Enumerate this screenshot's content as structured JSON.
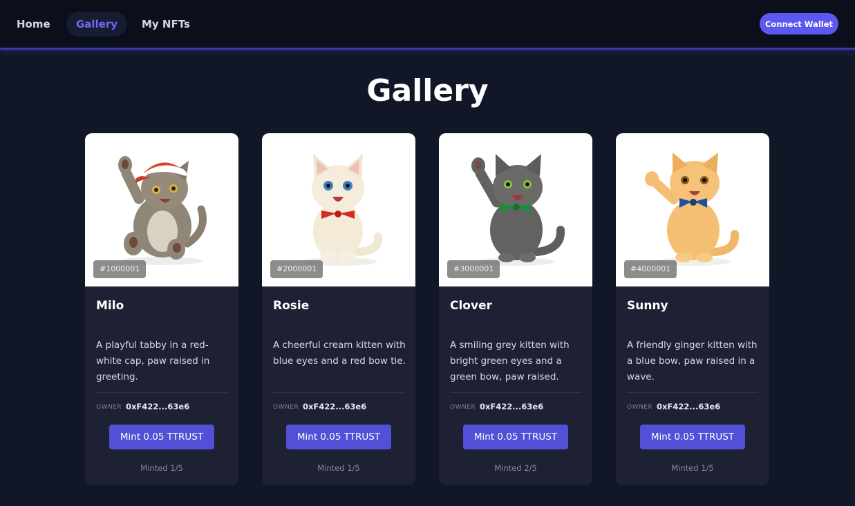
{
  "nav": {
    "links": [
      {
        "label": "Home"
      },
      {
        "label": "Gallery"
      },
      {
        "label": "My NFTs"
      }
    ],
    "connect_label": "Connect Wallet"
  },
  "page": {
    "title": "Gallery"
  },
  "colors": {
    "accent": "#5b57ef",
    "background": "#121727",
    "card": "#1d2133"
  },
  "cards": [
    {
      "token": "#1000001",
      "name": "Milo",
      "description": "A playful tabby in a red-white cap, paw raised in greeting.",
      "owner_label": "OWNER",
      "owner": "0xF422...63e6",
      "mint_label": "Mint 0.05 TTRUST",
      "minted": "Minted 1/5",
      "image": "tabby-kitten-with-cap-illustration"
    },
    {
      "token": "#2000001",
      "name": "Rosie",
      "description": "A cheerful cream kitten with blue eyes and a red bow tie.",
      "owner_label": "OWNER",
      "owner": "0xF422...63e6",
      "mint_label": "Mint 0.05 TTRUST",
      "minted": "Minted 1/5",
      "image": "cream-kitten-with-red-bow-illustration"
    },
    {
      "token": "#3000001",
      "name": "Clover",
      "description": "A smiling grey kitten with bright green eyes and a green bow, paw raised.",
      "owner_label": "OWNER",
      "owner": "0xF422...63e6",
      "mint_label": "Mint 0.05 TTRUST",
      "minted": "Minted 2/5",
      "image": "grey-kitten-with-green-bow-illustration"
    },
    {
      "token": "#4000001",
      "name": "Sunny",
      "description": "A friendly ginger kitten with a blue bow, paw raised in a wave.",
      "owner_label": "OWNER",
      "owner": "0xF422...63e6",
      "mint_label": "Mint 0.05 TTRUST",
      "minted": "Minted 1/5",
      "image": "ginger-kitten-with-blue-bow-illustration"
    }
  ]
}
